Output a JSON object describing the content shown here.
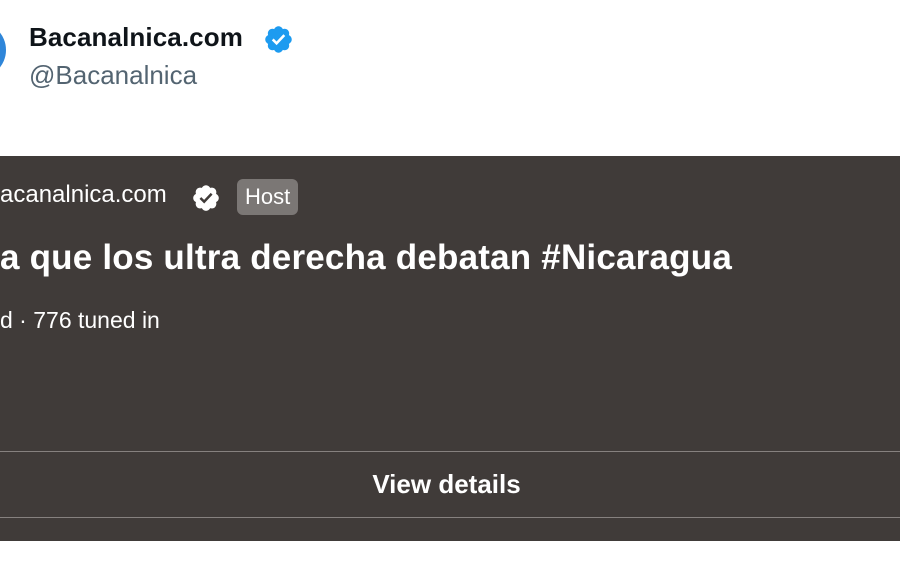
{
  "author": {
    "name": "Bacanalnica.com",
    "handle": "@Bacanalnica",
    "verified_icon": "verified-badge-icon",
    "verified_color": "#1d9bf0"
  },
  "space_card": {
    "host_name": "acanalnica.com",
    "host_badge": "Host",
    "title": "a que los ultra derecha debatan #Nicaragua",
    "meta": "d · 776 tuned in",
    "view_details_label": "View details",
    "background_color": "#403b39"
  }
}
